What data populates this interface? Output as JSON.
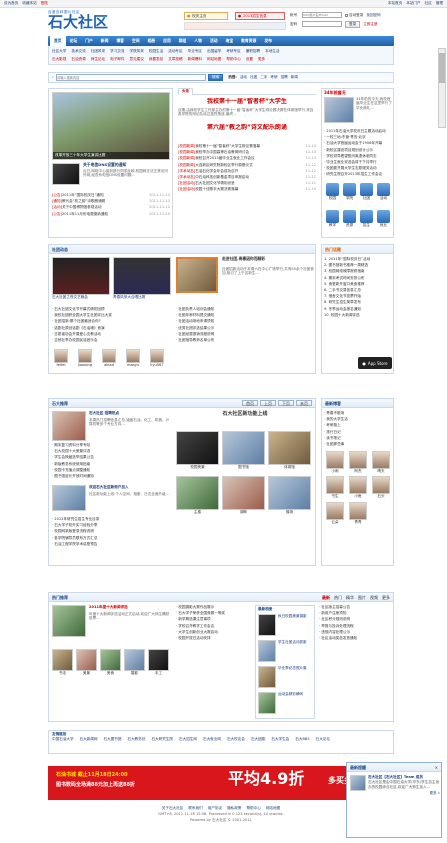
{
  "topbar": {
    "links": [
      "设为首页",
      "收藏本站",
      "登陆"
    ],
    "right_links": [
      "本站首页",
      "本站门户",
      "社区",
      "管理"
    ]
  },
  "logo": {
    "subtitle": "百度百科图片社区",
    "title": "石大社区"
  },
  "header_badges": [
    "校庆主页",
    "2013招生信息"
  ],
  "login": {
    "user_label": "帐号",
    "pass_label": "密码",
    "user_placeholder": "UID/用户名/Email",
    "auto_login": "自动登录",
    "forgot": "找回密码",
    "login_btn": "登录",
    "register": "立即注册"
  },
  "nav": {
    "items": [
      "首页",
      "论坛",
      "门户",
      "新闻",
      "博客",
      "空间",
      "相册",
      "应用",
      "群组",
      "人物",
      "活动",
      "淘宝",
      "教育资源",
      "发布"
    ],
    "sub_label": "快速导航"
  },
  "subnav": {
    "rows": [
      [
        "社区大学",
        "技术交流",
        "社团风采",
        "学习交流",
        "学院风采",
        "校园生活",
        "活动专区",
        "毕业专区",
        "出国留学",
        "考研专区",
        "兼职招聘",
        "本地生活"
      ],
      [
        "石大影视",
        "石油资源",
        "师生论坛",
        "电子邮件",
        "意见建议",
        "我要发帖",
        "文章投稿",
        "新闻爆料",
        "网站地图",
        "帮助中心",
        "设置",
        "更多"
      ]
    ]
  },
  "search": {
    "placeholder": "请输入搜索内容",
    "button": "搜索",
    "hot_label": "热搜:",
    "hot": [
      "活动",
      "社团",
      "二手",
      "考研",
      "招聘",
      "新闻"
    ]
  },
  "top_news": {
    "headline": "我校第十一届“智者杯”大学生",
    "intro": "近期,由我校学生工作部主办的第十一届“智者杯”大学生辩论赛决赛在体育馆举行,来自各学院的辩论队经过激烈角逐,最终...",
    "headline2": "第六届“教之韵”诗文配乐朗诵",
    "caption": "改革开放三十年大学生演讲比赛",
    "news": [
      {
        "tag": "[校园新闻]",
        "title": "我校第十一届“智者杯”大学生辩论赛落幕",
        "date": "11-14"
      },
      {
        "tag": "[校园新闻]",
        "title": "我校举办中国高等石油教育研讨会",
        "date": "11-13"
      },
      {
        "tag": "[校园新闻]",
        "title": "我校召开2013届毕业生就业工作会议",
        "date": "11-13"
      },
      {
        "tag": "[校园新闻]",
        "title": "大连新区研究院新校区举行奠基仪式",
        "date": "11-12"
      },
      {
        "tag": "[学术动态]",
        "title": "石油石化学会年会成功召开",
        "date": "11-12"
      },
      {
        "tag": "[学术动态]",
        "title": "中石油科技创新基金项目申报启动",
        "date": "11-11"
      },
      {
        "tag": "[社团活动]",
        "title": "石大社团文化节精彩纷呈",
        "date": "11-11"
      },
      {
        "tag": "[社团活动]",
        "title": "校园十佳歌手大赛决赛落幕",
        "date": "11-10"
      }
    ]
  },
  "left_feature": {
    "title": "关于电信DNS设置的通知",
    "desc": "近日,网络中心接到部分同学反映,校园网无法正常访问外网,经查系电信DNS设置问题...",
    "list": [
      {
        "tag": "[公告]",
        "title": "2011年“国际校庆日”通知",
        "date": "2011-11-14"
      },
      {
        "tag": "[通知]",
        "title": "教代会“校之韵”诗歌朗诵赛",
        "date": "2011-11-13"
      },
      {
        "tag": "[活动]",
        "title": "关于中国博物馆参观活动",
        "date": "2011-11-12"
      },
      {
        "tag": "[公告]",
        "title": "2011年11月份电费缴纳通知",
        "date": "2011-11-10"
      }
    ]
  },
  "right_news": {
    "title": "34年前盛况",
    "desc": "34年前的今天,我校首届毕业生在这里举行了毕业典礼...",
    "list": [
      "2011年石油大学校庆日主题活动启动",
      "一校三地:东营·青岛·北京",
      "石油大学首届运动会于1956年开幕",
      "新校区建设项目规划设计公示",
      "学校领导看望慰问离退休老同志",
      "毕业生就业双选会将于下月举行",
      "校团委开展大学生志愿服务活动",
      "研究生院召开2013年招生工作会议"
    ],
    "icons": [
      "校园",
      "学院",
      "社团",
      "活动",
      "教学",
      "资源",
      "招生",
      "就业"
    ]
  },
  "activity": {
    "title": "社团动态",
    "videos": [
      {
        "label": "石大社团之夜文艺晚会"
      },
      {
        "label": "青春风采大合唱比赛"
      }
    ],
    "feature_title": "走进社团,青春因你而精彩",
    "feature_desc": "社团招新活动于本周六在中心广场举行,共有80余个社团参加,吸引了上千名新生...",
    "list": [
      "石大社团文化节开幕式精彩回顾",
      "我校社团获全国大学生社团评比大奖",
      "社团招新:哪个社团最适合你?",
      "话剧社原创话剧《石油魂》首演",
      "志愿者协会开展爱心支教活动",
      "吉他社举办校园民谣音乐会"
    ],
    "bottom_list": [
      "社团负责人培训会通知",
      "社团年审材料提交通知",
      "社团活动场地申请须知",
      "优秀社团评选结果公示",
      "社团经费报销流程说明",
      "社团指导教师名单公布"
    ],
    "users": [
      "feifei",
      "jiaoqing",
      "akiad",
      "maoyu",
      "liyu567"
    ]
  },
  "hot_section": {
    "title": "热门话题",
    "list": [
      "2011年“国际校庆日”活动",
      "图书馆新书推荐一周精选",
      "校园网络故障报修指南",
      "期末考试时间安排公布",
      "食堂新开窗口美食推荐",
      "二手书交易信息汇总",
      "宿舍文化节投票开始",
      "研究生招生简章发布",
      "冬季运动会报名通知",
      "校园十大新闻评选"
    ],
    "app_label": "App Store"
  },
  "mid_section": {
    "title": "石大推荐",
    "pager": [
      "首页",
      "上页",
      "下页",
      "末页"
    ],
    "feature_title": "石大社区·招聘热点",
    "feature_desc": "本周热门招聘信息汇总,涵盖石油、化工、机械、计算机等多个专业方向...",
    "head_title": "欢迎石大社区新用户加入",
    "head_desc": "社区新功能上线:个人空间、相册、日志全面升级...",
    "left_list": [
      "期末复习资料分享专帖",
      "石大校园十大美景评选",
      "学生会换届选举结果公告",
      "新版教务系统使用指南",
      "校园卡充值点调整通知",
      "图书馆延长开放时间通知"
    ],
    "left_list2": [
      "2012年研究生招生专业目录",
      "石大学子校外实习经验分享",
      "校园网新版登录流程说明",
      "各学院辅导员联系方式汇总",
      "石油工程学院学术讲座预告"
    ],
    "photos": [
      "校园夜景",
      "图书馆",
      "体育馆",
      "主楼",
      "湖畔",
      "操场"
    ],
    "right_col": {
      "title": "最新博客",
      "list": [
        "青春不散场",
        "我的大学生活",
        "考研路上",
        "旅行日记",
        "读书笔记",
        "社团那些事"
      ],
      "avatars": [
        "小雨",
        "阿杰",
        "晴天",
        "书生",
        "小鱼",
        "石头",
        "云朵",
        "青青"
      ]
    }
  },
  "bottom_section": {
    "title": "热门推荐",
    "tabs": [
      "最新",
      "热门",
      "精华",
      "图片",
      "视频",
      "更多"
    ],
    "feature": "2011年度十大新闻评选",
    "feature_desc": "年度十大新闻评选活动正式启动,欢迎广大师生踊跃投票...",
    "list": [
      "校园摄影大赛作品展示",
      "石大学子荣获全国竞赛一等奖",
      "新学期选课注意事项",
      "学校召开教学工作会议",
      "大学生创新创业大赛启动",
      "校园开放日活动安排"
    ],
    "gallery": [
      "书法",
      "美景",
      "美食",
      "摄影",
      "手工"
    ],
    "app_box": {
      "title": "最新相册",
      "items": [
        "秋日校园美景摄影",
        "学生社团活动剪影",
        "毕业季纪念照片集",
        "运动会精彩瞬间"
      ]
    },
    "side_list": [
      "社区版主招募公告",
      "新用户注册须知",
      "社区积分规则说明",
      "举报与投诉处理流程",
      "违规内容处理公示",
      "社区活动奖品发放通知"
    ]
  },
  "friend_links": {
    "title": "友情链接",
    "links": [
      "中国石油大学",
      "石大新闻网",
      "石大图书馆",
      "石大教务处",
      "石大研究生院",
      "石大招生网",
      "石大就业网",
      "石大校友会",
      "石大团委",
      "石大学生会",
      "石大BBS",
      "石大论坛"
    ]
  },
  "banner": {
    "left_top": "石油书城 截止11月18日24:00",
    "left_bottom": "图书数码全场满88元加上再送88折",
    "big": "平均4.9折",
    "right": "多买多省最"
  },
  "footer": {
    "links": [
      "关于石大社区",
      "联系我们",
      "用户协议",
      "隐私政策",
      "帮助中心",
      "网站地图"
    ],
    "copyright": "GMT+8, 2011-11-16 15:58, Processed in 0.123 second(s), 10 queries.",
    "powered": "Powered by 石大社区 © 2001-2011"
  },
  "popup": {
    "title": "最新提醒",
    "heading": "石大社区【石大社区】Team 成员",
    "desc": "石大社区是由中国石油大学(华东)学生自主创办的校园综合社区,欢迎广大师生加入...",
    "more": "更多 »"
  }
}
